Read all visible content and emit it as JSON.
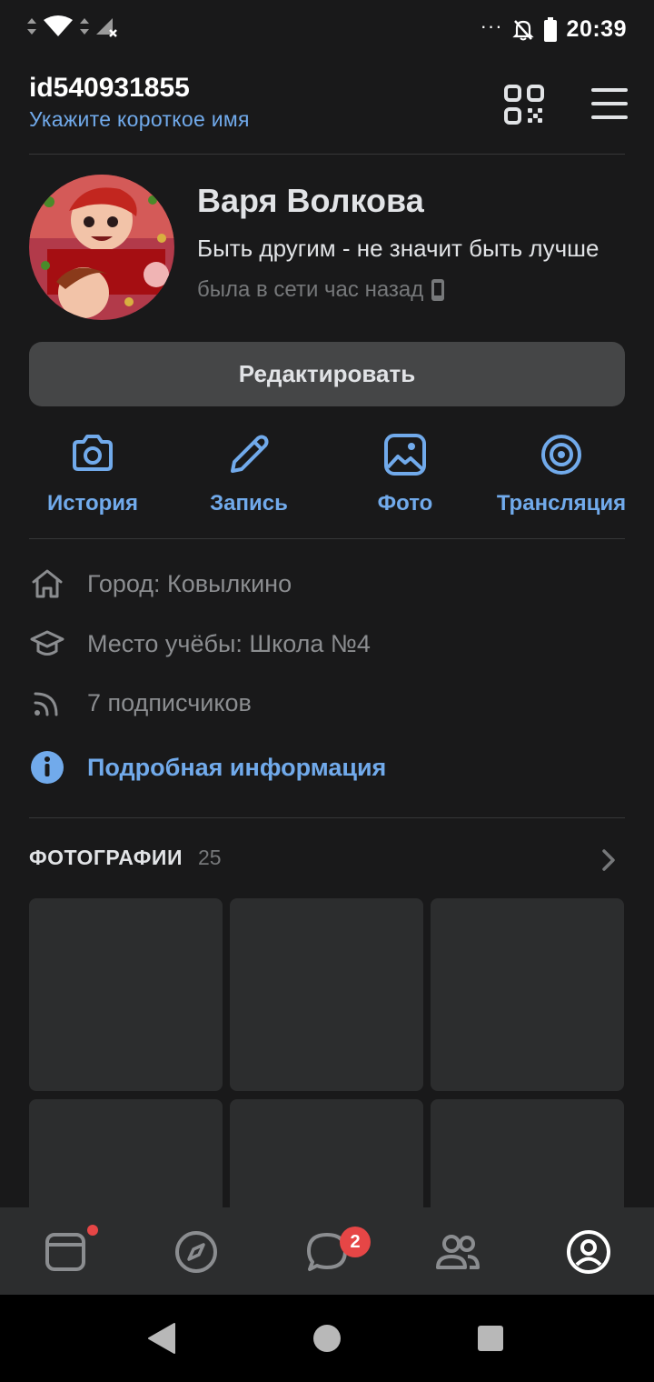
{
  "status_bar": {
    "time": "20:39",
    "more": "···"
  },
  "header": {
    "user_id": "id540931855",
    "short_name_link": "Укажите короткое имя"
  },
  "profile": {
    "name": "Варя Волкова",
    "status": "Быть другим - не значит быть лучше",
    "online": "была в сети час назад"
  },
  "edit_button": "Редактировать",
  "actions": [
    {
      "label": "История",
      "icon": "camera-icon"
    },
    {
      "label": "Запись",
      "icon": "pencil-icon"
    },
    {
      "label": "Фото",
      "icon": "image-icon"
    },
    {
      "label": "Трансляция",
      "icon": "broadcast-icon"
    }
  ],
  "info": {
    "city": "Город: Ковылкино",
    "school": "Место учёбы: Школа №4",
    "followers": "7 подписчиков",
    "details_link": "Подробная информация"
  },
  "photos": {
    "title": "ФОТОГРАФИИ",
    "count": "25"
  },
  "tabbar": {
    "items": [
      "newsfeed-icon",
      "explore-icon",
      "messages-icon",
      "friends-icon",
      "profile-icon"
    ],
    "messages_badge": "2"
  },
  "colors": {
    "background": "#19191a",
    "accent": "#71aaeb",
    "secondary_text": "#8b8d90",
    "badge": "#e64646"
  }
}
